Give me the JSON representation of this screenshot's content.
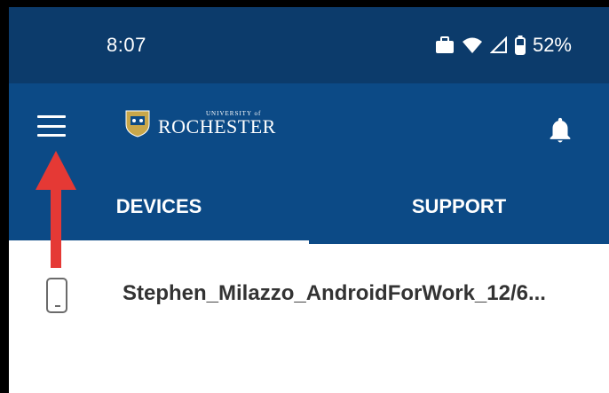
{
  "status_bar": {
    "time": "8:07",
    "battery_percent": "52%",
    "icons": [
      "briefcase-icon",
      "wifi-icon",
      "signal-icon",
      "battery-icon"
    ]
  },
  "app_bar": {
    "logo_small": "UNIVERSITY of",
    "logo_big": "ROCHESTER",
    "menu_icon": "hamburger-menu-icon",
    "notification_icon": "bell-icon"
  },
  "tabs": [
    {
      "label": "DEVICES",
      "active": true
    },
    {
      "label": "SUPPORT",
      "active": false
    }
  ],
  "devices": [
    {
      "name": "Stephen_Milazzo_AndroidForWork_12/6..."
    }
  ],
  "colors": {
    "status_bar_bg": "#0c3b6b",
    "app_bar_bg": "#0c4a86",
    "annotation_arrow": "#e53935"
  }
}
